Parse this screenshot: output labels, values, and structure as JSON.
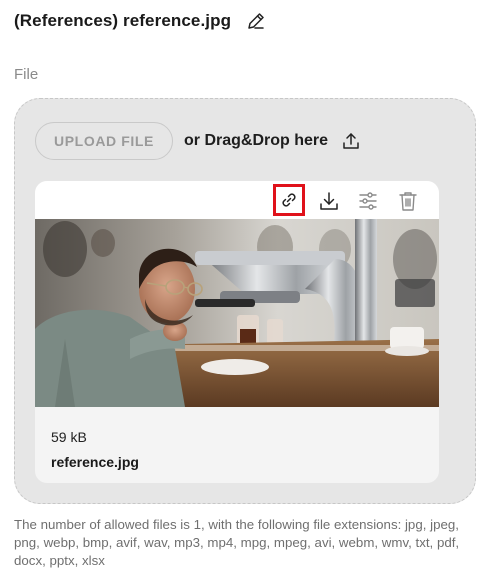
{
  "header": {
    "title": "(References) reference.jpg",
    "edit_icon": "pencil-icon"
  },
  "field": {
    "label": "File"
  },
  "dropzone": {
    "upload_button_label": "UPLOAD FILE",
    "drag_drop_text": "or Drag&Drop here",
    "upload_icon": "upload-icon"
  },
  "file_card": {
    "toolbar": {
      "link_icon": "link-icon",
      "download_icon": "download-icon",
      "adjust_icon": "sliders-icon",
      "delete_icon": "trash-icon",
      "highlight_color": "#e0111a"
    },
    "image_alt": "Man with glasses pouring coffee at an espresso machine",
    "size": "59 kB",
    "name": "reference.jpg"
  },
  "help_text": "The number of allowed files is 1, with the following file extensions: jpg, jpeg, png, webp, bmp, avif, wav, mp3, mp4, mpg, mpeg, avi, webm, wmv, txt, pdf, docx, pptx, xlsx",
  "colors": {
    "dropzone_bg": "#e6e6e6",
    "dropzone_border": "#c7c7c7",
    "muted_text": "#8a8a8a"
  }
}
